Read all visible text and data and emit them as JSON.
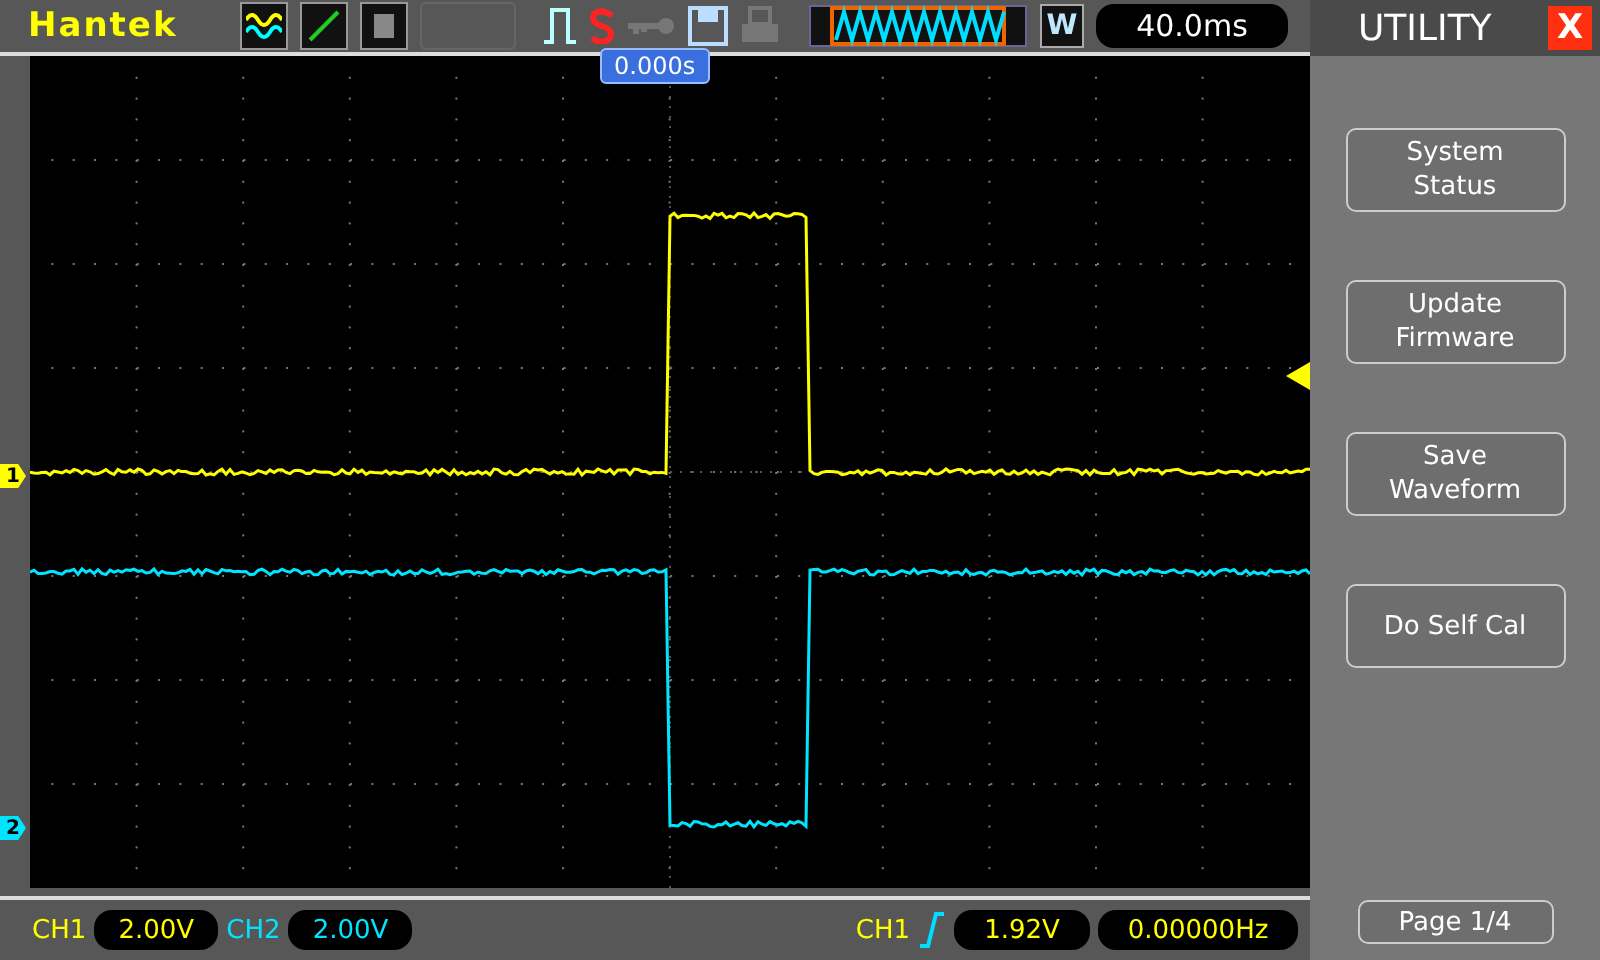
{
  "header": {
    "brand": "Hantek",
    "timebase_mode": "W",
    "timebase": "40.0ms",
    "trigger_position": "0.000s"
  },
  "channels": [
    {
      "marker": "1",
      "label": "CH1",
      "scale": "2.00V",
      "color": "#ffff00"
    },
    {
      "marker": "2",
      "label": "CH2",
      "scale": "2.00V",
      "color": "#00e5ff"
    }
  ],
  "trigger": {
    "source": "CH1",
    "level": "1.92V",
    "frequency": "0.00000Hz"
  },
  "menu": {
    "title": "UTILITY",
    "close": "X",
    "items": [
      [
        "System",
        "Status"
      ],
      [
        "Update",
        "Firmware"
      ],
      [
        "Save",
        "Waveform"
      ],
      [
        "Do Self Cal"
      ]
    ],
    "page": "Page 1/4"
  }
}
